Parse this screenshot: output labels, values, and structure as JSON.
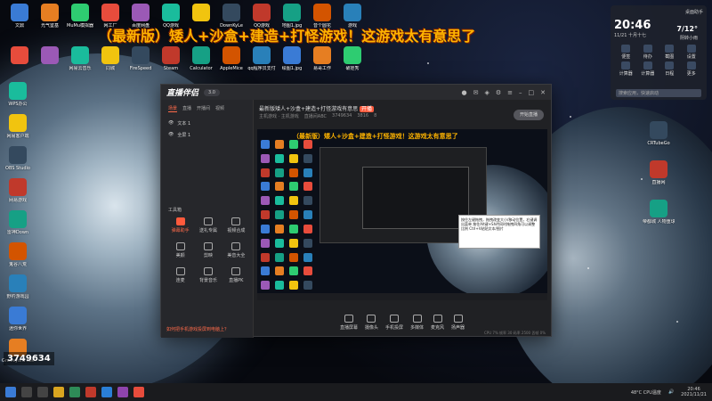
{
  "banner": "（最新版）矮人+沙盒+建造+打怪游戏！这游戏太有意思了",
  "desktop_icons_top": [
    "文鼎",
    "光气鉴基",
    "MuMu模拟器",
    "网工厂",
    "百度网盘",
    "QQ游戏",
    "",
    "DownKyLe",
    "QQ游戏",
    "地图1.jpg",
    "音个圆花",
    "游戏"
  ],
  "desktop_icons_row2": [
    "",
    "",
    "网易云音乐",
    "同城",
    "FireSpeed",
    "Steam",
    "Calculator",
    "AppleMice",
    "qq程序员支付",
    "绘图1.jpg",
    "易哥工作",
    "破娃秀"
  ],
  "desktop_icons_left": [
    "WPS办公",
    "网易客户端",
    "OBS Studio",
    "网易游戏",
    "雷神Down",
    "鬼谷八荒",
    "野钓游戏园",
    "迷你世界",
    "Graveyard Keeper"
  ],
  "desktop_icons_right": [
    "CRTubeGo",
    "直播网",
    "帝都城 人物重球.docx"
  ],
  "widget": {
    "title": "桌面助手",
    "time": "20:46",
    "date": "11/21",
    "lunar": "十月十七",
    "weather_temp": "7/12°",
    "weather_desc": "阴转小雨",
    "tools": [
      "便签",
      "待办",
      "截图",
      "设置",
      "计算器",
      "计算器",
      "日程",
      "更多"
    ],
    "search": "搜索应用，快速启动"
  },
  "obs": {
    "logo": "直播伴侣",
    "version": "3.0",
    "left_tabs": [
      "场景",
      "直播",
      "开播间",
      "视频"
    ],
    "scenes": [
      "文本 1",
      "全屏 1"
    ],
    "tools_title": "工具箱",
    "tools": [
      "弹幕助手",
      "送礼专属",
      "视频合成",
      "美颜",
      "剪映",
      "美音大全",
      "连麦",
      "背景音乐",
      "直播PK"
    ],
    "notice": "如何把手机游戏投屏到电脑上？",
    "stream_title": "最新版矮人+沙盒+建造+打怪游戏有意思",
    "stream_tag": "开播",
    "stream_sub": "主机游戏 · 主机游戏",
    "viewer_label": "直播间ABC",
    "stat1": "3749634",
    "stat2": "3816",
    "stat3": "8",
    "controls": [
      "直播屏幕",
      "摄像头",
      "手机投屏",
      "多媒体",
      "麦克风",
      "扬声器"
    ],
    "golive": "开始直播",
    "stats_line": "CPU 7%  帧率 30  码率 2500  丢帧 0%",
    "preview_banner": "（最新版）矮人+沙盒+建造+打怪游戏！这游戏太有意思了",
    "preview_tip": "按住左键拖拽，拖拽改变大小/移动位置，右键调出菜单 按住Alt键+Shift同时拖拽四角可以调整比例 Ctrl+V粘贴文本/图片"
  },
  "viewers": "3749634",
  "taskbar": {
    "temp": "48°C",
    "cpu": "CPU温度",
    "time": "20:46",
    "date": "2021/11/21"
  }
}
